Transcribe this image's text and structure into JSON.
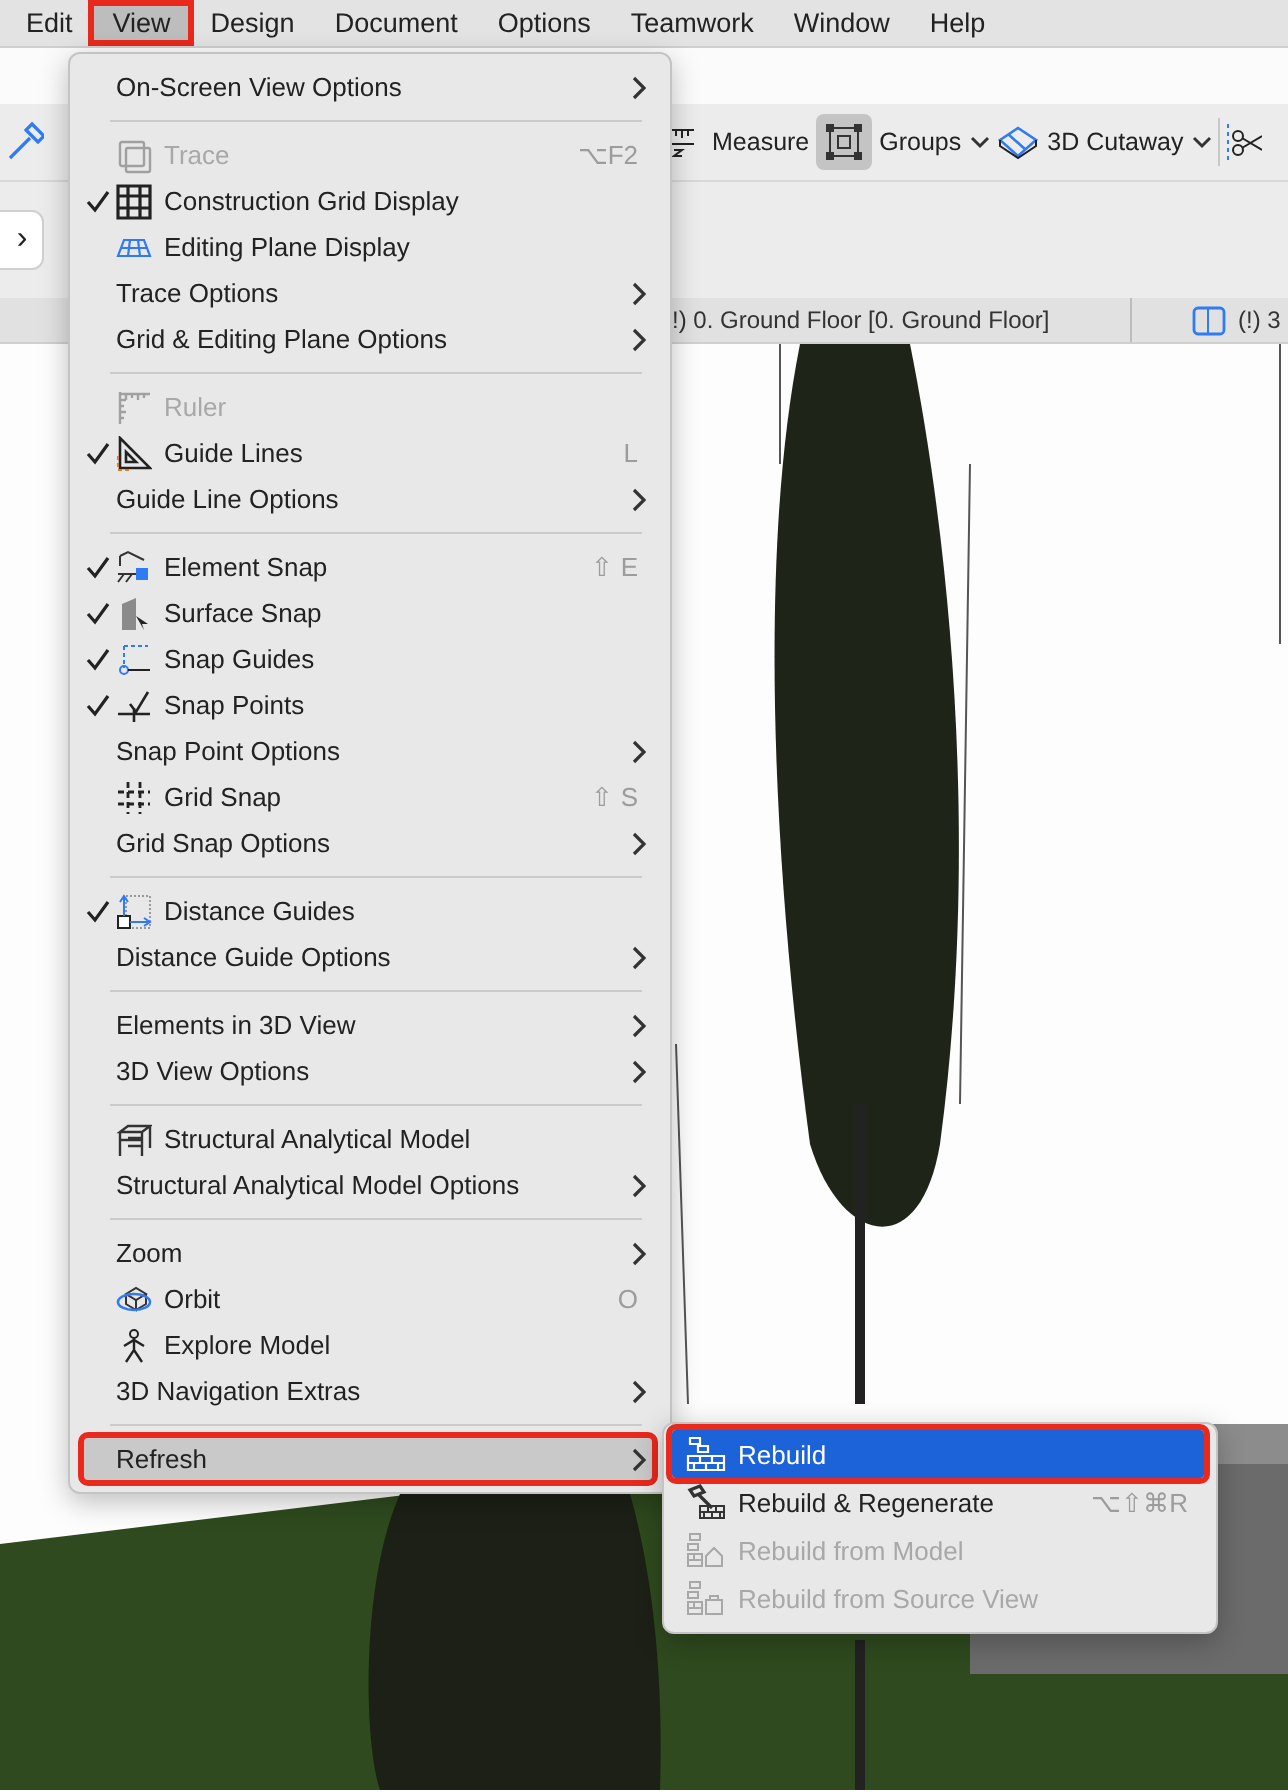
{
  "menubar": {
    "items": [
      {
        "label": "Edit",
        "selected": false,
        "annotated": false
      },
      {
        "label": "View",
        "selected": true,
        "annotated": true
      },
      {
        "label": "Design",
        "selected": false,
        "annotated": false
      },
      {
        "label": "Document",
        "selected": false,
        "annotated": false
      },
      {
        "label": "Options",
        "selected": false,
        "annotated": false
      },
      {
        "label": "Teamwork",
        "selected": false,
        "annotated": false
      },
      {
        "label": "Window",
        "selected": false,
        "annotated": false
      },
      {
        "label": "Help",
        "selected": false,
        "annotated": false
      }
    ]
  },
  "toolbar": {
    "items": [
      {
        "kind": "button",
        "label": "Measure",
        "selected": false
      },
      {
        "kind": "dropdown",
        "label": "Groups",
        "selected": true
      },
      {
        "kind": "dropdown",
        "label": "3D Cutaway",
        "selected": false
      }
    ],
    "nav_button": {
      "label": "›"
    }
  },
  "view_tabs": [
    {
      "label": "!) 0. Ground Floor [0. Ground Floor]"
    },
    {
      "label": "(!) 3"
    }
  ],
  "view_menu": {
    "items": [
      {
        "kind": "item",
        "label": "On-Screen View Options",
        "checked": false,
        "disabled": false,
        "selected": false,
        "annotated": false,
        "has_submenu": true
      },
      {
        "kind": "separator"
      },
      {
        "kind": "item",
        "label": "Trace",
        "shortcut": "⌥F2",
        "checked": false,
        "disabled": true,
        "selected": false,
        "annotated": false,
        "has_submenu": false
      },
      {
        "kind": "item",
        "label": "Construction Grid Display",
        "checked": true,
        "disabled": false,
        "selected": false,
        "annotated": false,
        "has_submenu": false
      },
      {
        "kind": "item",
        "label": "Editing Plane Display",
        "checked": false,
        "disabled": false,
        "selected": false,
        "annotated": false,
        "has_submenu": false
      },
      {
        "kind": "item",
        "label": "Trace Options",
        "checked": false,
        "disabled": false,
        "selected": false,
        "annotated": false,
        "has_submenu": true
      },
      {
        "kind": "item",
        "label": "Grid & Editing Plane Options",
        "checked": false,
        "disabled": false,
        "selected": false,
        "annotated": false,
        "has_submenu": true
      },
      {
        "kind": "separator"
      },
      {
        "kind": "item",
        "label": "Ruler",
        "checked": false,
        "disabled": true,
        "selected": false,
        "annotated": false,
        "has_submenu": false
      },
      {
        "kind": "item",
        "label": "Guide Lines",
        "shortcut": "L",
        "checked": true,
        "disabled": false,
        "selected": false,
        "annotated": false,
        "has_submenu": false
      },
      {
        "kind": "item",
        "label": "Guide Line Options",
        "checked": false,
        "disabled": false,
        "selected": false,
        "annotated": false,
        "has_submenu": true
      },
      {
        "kind": "separator"
      },
      {
        "kind": "item",
        "label": "Element Snap",
        "shortcut": "⇧ E",
        "checked": true,
        "disabled": false,
        "selected": false,
        "annotated": false,
        "has_submenu": false
      },
      {
        "kind": "item",
        "label": "Surface Snap",
        "checked": true,
        "disabled": false,
        "selected": false,
        "annotated": false,
        "has_submenu": false
      },
      {
        "kind": "item",
        "label": "Snap Guides",
        "checked": true,
        "disabled": false,
        "selected": false,
        "annotated": false,
        "has_submenu": false
      },
      {
        "kind": "item",
        "label": "Snap Points",
        "checked": true,
        "disabled": false,
        "selected": false,
        "annotated": false,
        "has_submenu": false
      },
      {
        "kind": "item",
        "label": "Snap Point Options",
        "checked": false,
        "disabled": false,
        "selected": false,
        "annotated": false,
        "has_submenu": true
      },
      {
        "kind": "item",
        "label": "Grid Snap",
        "shortcut": "⇧ S",
        "checked": false,
        "disabled": false,
        "selected": false,
        "annotated": false,
        "has_submenu": false
      },
      {
        "kind": "item",
        "label": "Grid Snap Options",
        "checked": false,
        "disabled": false,
        "selected": false,
        "annotated": false,
        "has_submenu": true
      },
      {
        "kind": "separator"
      },
      {
        "kind": "item",
        "label": "Distance Guides",
        "checked": true,
        "disabled": false,
        "selected": false,
        "annotated": false,
        "has_submenu": false
      },
      {
        "kind": "item",
        "label": "Distance Guide Options",
        "checked": false,
        "disabled": false,
        "selected": false,
        "annotated": false,
        "has_submenu": true
      },
      {
        "kind": "separator"
      },
      {
        "kind": "item",
        "label": "Elements in 3D View",
        "checked": false,
        "disabled": false,
        "selected": false,
        "annotated": false,
        "has_submenu": true
      },
      {
        "kind": "item",
        "label": "3D View Options",
        "checked": false,
        "disabled": false,
        "selected": false,
        "annotated": false,
        "has_submenu": true
      },
      {
        "kind": "separator"
      },
      {
        "kind": "item",
        "label": "Structural Analytical Model",
        "checked": false,
        "disabled": false,
        "selected": false,
        "annotated": false,
        "has_submenu": false
      },
      {
        "kind": "item",
        "label": "Structural Analytical Model Options",
        "checked": false,
        "disabled": false,
        "selected": false,
        "annotated": false,
        "has_submenu": true
      },
      {
        "kind": "separator"
      },
      {
        "kind": "item",
        "label": "Zoom",
        "checked": false,
        "disabled": false,
        "selected": false,
        "annotated": false,
        "has_submenu": true
      },
      {
        "kind": "item",
        "label": "Orbit",
        "shortcut": "O",
        "checked": false,
        "disabled": false,
        "selected": false,
        "annotated": false,
        "has_submenu": false
      },
      {
        "kind": "item",
        "label": "Explore Model",
        "checked": false,
        "disabled": false,
        "selected": false,
        "annotated": false,
        "has_submenu": false
      },
      {
        "kind": "item",
        "label": "3D Navigation Extras",
        "checked": false,
        "disabled": false,
        "selected": false,
        "annotated": false,
        "has_submenu": true
      },
      {
        "kind": "separator"
      },
      {
        "kind": "item",
        "label": "Refresh",
        "checked": false,
        "disabled": false,
        "selected": true,
        "annotated": true,
        "has_submenu": true
      }
    ]
  },
  "refresh_submenu": {
    "items": [
      {
        "label": "Rebuild",
        "disabled": false,
        "selected": true,
        "annotated": true
      },
      {
        "label": "Rebuild & Regenerate",
        "shortcut": "⌥⇧⌘R",
        "disabled": false,
        "selected": false,
        "annotated": false
      },
      {
        "label": "Rebuild from Model",
        "disabled": true,
        "selected": false,
        "annotated": false
      },
      {
        "label": "Rebuild from Source View",
        "disabled": true,
        "selected": false,
        "annotated": false
      }
    ]
  }
}
